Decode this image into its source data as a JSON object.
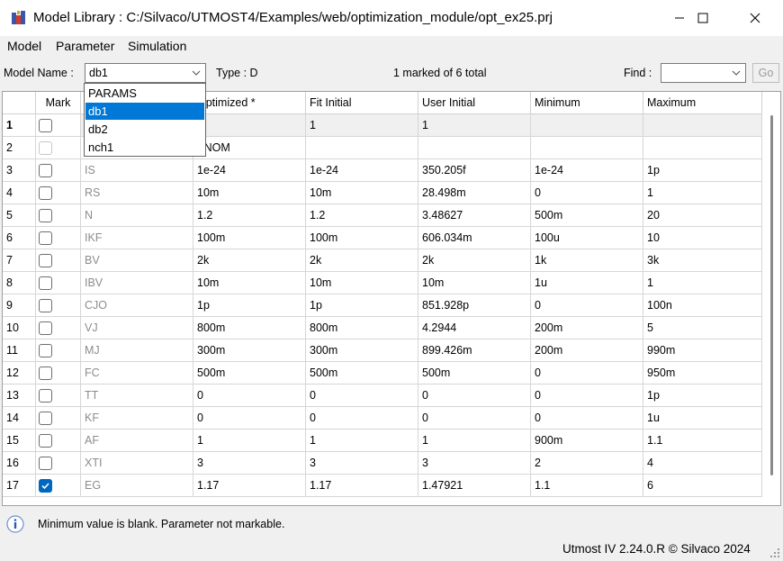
{
  "window": {
    "title": "Model Library : C:/Silvaco/UTMOST4/Examples/web/optimization_module/opt_ex25.prj"
  },
  "menu": [
    "Model",
    "Parameter",
    "Simulation"
  ],
  "toolbar": {
    "model_name_label": "Model Name :",
    "model_name_value": "db1",
    "type_label": "Type : D",
    "marked_count": "1 marked of 6 total",
    "find_label": "Find :",
    "find_value": "",
    "go_label": "Go"
  },
  "dropdown": {
    "options": [
      "PARAMS",
      "db1",
      "db2",
      "nch1"
    ],
    "selected": "db1"
  },
  "table": {
    "columns": [
      "",
      "Mark",
      "",
      "Optimized *",
      "Fit Initial",
      "User Initial",
      "Minimum",
      "Maximum"
    ],
    "rows": [
      {
        "n": "1",
        "mark": "unchecked",
        "name": "",
        "opt": "",
        "fit": "1",
        "user": "1",
        "min": "",
        "max": ""
      },
      {
        "n": "2",
        "mark": "dim",
        "name": "",
        "opt": "TNOM",
        "fit": "",
        "user": "",
        "min": "",
        "max": ""
      },
      {
        "n": "3",
        "mark": "unchecked",
        "name": "IS",
        "opt": "1e-24",
        "fit": "1e-24",
        "user": "350.205f",
        "min": "1e-24",
        "max": "1p"
      },
      {
        "n": "4",
        "mark": "unchecked",
        "name": "RS",
        "opt": "10m",
        "fit": "10m",
        "user": "28.498m",
        "min": "0",
        "max": "1"
      },
      {
        "n": "5",
        "mark": "unchecked",
        "name": "N",
        "opt": "1.2",
        "fit": "1.2",
        "user": "3.48627",
        "min": "500m",
        "max": "20"
      },
      {
        "n": "6",
        "mark": "unchecked",
        "name": "IKF",
        "opt": "100m",
        "fit": "100m",
        "user": "606.034m",
        "min": "100u",
        "max": "10"
      },
      {
        "n": "7",
        "mark": "unchecked",
        "name": "BV",
        "opt": "2k",
        "fit": "2k",
        "user": "2k",
        "min": "1k",
        "max": "3k"
      },
      {
        "n": "8",
        "mark": "unchecked",
        "name": "IBV",
        "opt": "10m",
        "fit": "10m",
        "user": "10m",
        "min": "1u",
        "max": "1"
      },
      {
        "n": "9",
        "mark": "unchecked",
        "name": "CJO",
        "opt": "1p",
        "fit": "1p",
        "user": "851.928p",
        "min": "0",
        "max": "100n"
      },
      {
        "n": "10",
        "mark": "unchecked",
        "name": "VJ",
        "opt": "800m",
        "fit": "800m",
        "user": "4.2944",
        "min": "200m",
        "max": "5"
      },
      {
        "n": "11",
        "mark": "unchecked",
        "name": "MJ",
        "opt": "300m",
        "fit": "300m",
        "user": "899.426m",
        "min": "200m",
        "max": "990m"
      },
      {
        "n": "12",
        "mark": "unchecked",
        "name": "FC",
        "opt": "500m",
        "fit": "500m",
        "user": "500m",
        "min": "0",
        "max": "950m"
      },
      {
        "n": "13",
        "mark": "unchecked",
        "name": "TT",
        "opt": "0",
        "fit": "0",
        "user": "0",
        "min": "0",
        "max": "1p"
      },
      {
        "n": "14",
        "mark": "unchecked",
        "name": "KF",
        "opt": "0",
        "fit": "0",
        "user": "0",
        "min": "0",
        "max": "1u"
      },
      {
        "n": "15",
        "mark": "unchecked",
        "name": "AF",
        "opt": "1",
        "fit": "1",
        "user": "1",
        "min": "900m",
        "max": "1.1"
      },
      {
        "n": "16",
        "mark": "unchecked",
        "name": "XTI",
        "opt": "3",
        "fit": "3",
        "user": "3",
        "min": "2",
        "max": "4"
      },
      {
        "n": "17",
        "mark": "checked",
        "name": "EG",
        "opt": "1.17",
        "fit": "1.17",
        "user": "1.47921",
        "min": "1.1",
        "max": "6"
      }
    ]
  },
  "status": {
    "message": "Minimum value is blank. Parameter not markable.",
    "version": "Utmost IV 2.24.0.R © Silvaco 2024"
  },
  "colors": {
    "selection": "#0078d7",
    "checkbox_checked": "#0067c0"
  }
}
